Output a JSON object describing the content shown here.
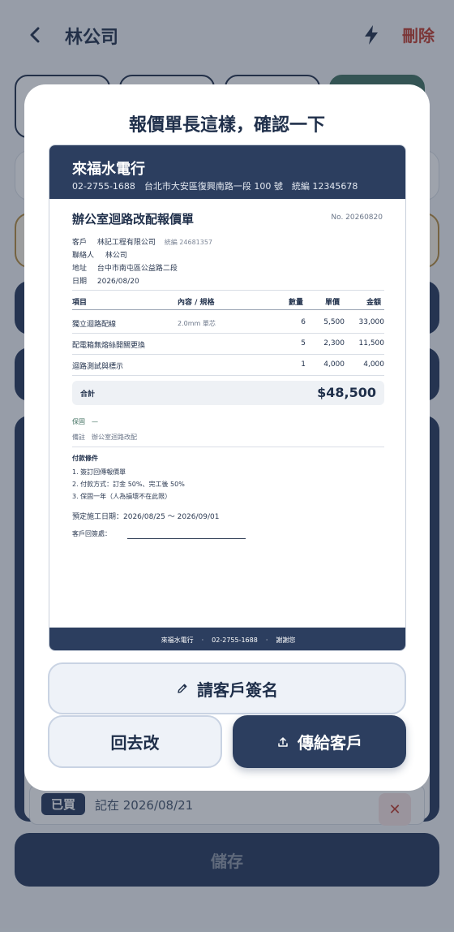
{
  "header": {
    "title": "林公司",
    "delete_label": "刪除"
  },
  "bought": {
    "badge": "已買",
    "text": "記在 2026/08/21",
    "remove_icon": "✕"
  },
  "save_label": "儲存",
  "modal": {
    "title": "報價單長這樣，確認一下",
    "sign_button": "請客戶簽名",
    "back_button": "回去改",
    "send_button": "傳給客戶"
  },
  "quote": {
    "company": "來福水電行",
    "company_info": "02-2755-1688　台北市大安區復興南路一段 100 號　統編 12345678",
    "title": "辦公室迴路改配報價單",
    "number": "No. 20260820",
    "customer_label": "客戶",
    "customer": "林記工程有限公司",
    "customer_tax": "統編 24681357",
    "contact_label": "聯絡人",
    "contact": "林公司",
    "address_label": "地址",
    "address": "台中市南屯區公益路二段",
    "date_label": "日期",
    "date": "2026/08/20",
    "columns": {
      "item": "項目",
      "spec": "內容 / 規格",
      "qty": "數量",
      "price": "單價",
      "amount": "金額"
    },
    "rows": [
      {
        "item": "獨立迴路配線",
        "spec": "2.0mm 單芯",
        "qty": "6",
        "price": "5,500",
        "amount": "33,000"
      },
      {
        "item": "配電箱無熔絲開關更換",
        "spec": "",
        "qty": "5",
        "price": "2,300",
        "amount": "11,500"
      },
      {
        "item": "迴路測試與標示",
        "spec": "",
        "qty": "1",
        "price": "4,000",
        "amount": "4,000"
      }
    ],
    "total_label": "合計",
    "total": "$48,500",
    "warranty": "保固　—",
    "note": "備註　辦公室迴路改配",
    "terms_title": "付款條件",
    "terms": [
      "1. 簽訂回傳報價單",
      "2. 付款方式：訂金 50%、完工後 50%",
      "3. 保固一年（人為損壞不在此限）"
    ],
    "schedule": "預定施工日期：2026/08/25 ～ 2026/09/01",
    "sign_label": "客戶回簽處：",
    "footer": {
      "company": "來福水電行",
      "phone": "02-2755-1688",
      "thanks": "謝謝您",
      "sep": "·"
    }
  },
  "icons": {
    "back": "chevron-left-icon",
    "bolt": "bolt-icon",
    "pencil": "pencil-icon",
    "upload": "upload-icon"
  },
  "colors": {
    "navy": "#2c3e5f",
    "danger": "#c0392b",
    "accent_green": "#3f6f5f"
  }
}
